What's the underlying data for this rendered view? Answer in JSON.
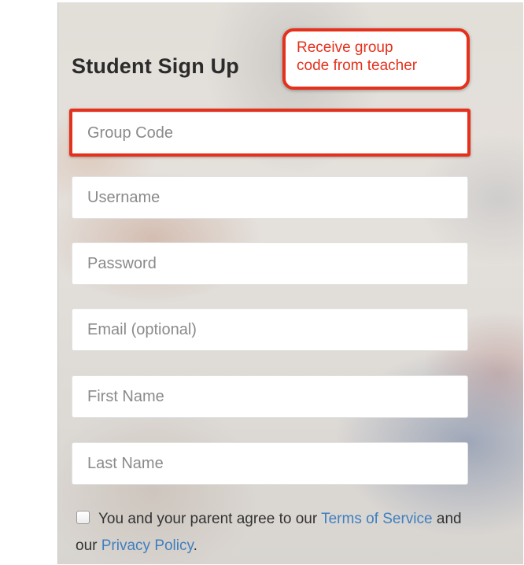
{
  "form": {
    "title": "Student Sign Up",
    "callout": {
      "line1": "Receive group",
      "line2": "code from teacher"
    },
    "fields": {
      "group_code": {
        "placeholder": "Group Code",
        "value": ""
      },
      "username": {
        "placeholder": "Username",
        "value": ""
      },
      "password": {
        "placeholder": "Password",
        "value": ""
      },
      "email": {
        "placeholder": "Email (optional)",
        "value": ""
      },
      "first_name": {
        "placeholder": "First Name",
        "value": ""
      },
      "last_name": {
        "placeholder": "Last Name",
        "value": ""
      }
    },
    "agreement": {
      "checked": false,
      "text_before": "You and your parent agree to our ",
      "terms_link": "Terms of Service",
      "text_middle": " and our ",
      "privacy_link": "Privacy Policy",
      "text_after": "."
    }
  },
  "colors": {
    "accent_red": "#e5301c",
    "link_blue": "#3f7fbf",
    "title_text": "#2b2b2b",
    "placeholder_text": "#8a8a8a"
  }
}
